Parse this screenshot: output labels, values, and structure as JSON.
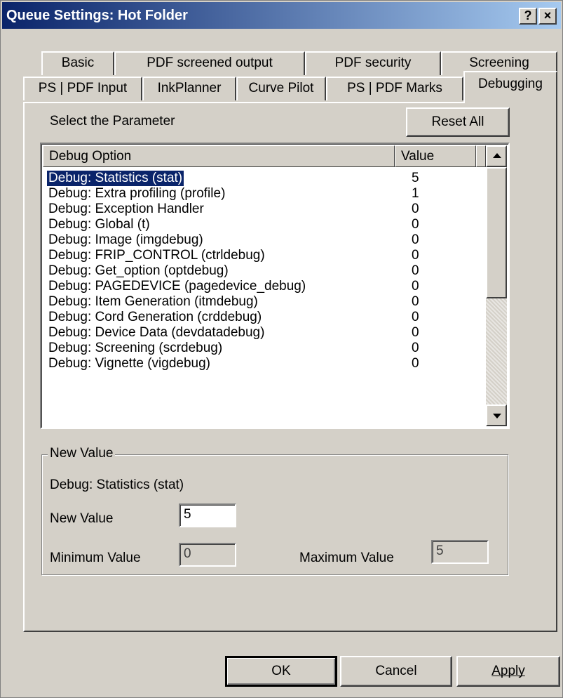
{
  "window": {
    "title": "Queue Settings: Hot Folder",
    "help_label": "?",
    "close_label": "×"
  },
  "tabs_row1": [
    {
      "label": "Basic"
    },
    {
      "label": "PDF screened output"
    },
    {
      "label": "PDF security"
    },
    {
      "label": "Screening"
    }
  ],
  "tabs_row2": [
    {
      "label": "PS | PDF Input"
    },
    {
      "label": "InkPlanner"
    },
    {
      "label": "Curve Pilot"
    },
    {
      "label": "PS | PDF Marks"
    },
    {
      "label": "Debugging"
    }
  ],
  "active_tab": "Debugging",
  "panel": {
    "select_label": "Select the Parameter",
    "reset_all_label": "Reset All"
  },
  "list": {
    "columns": [
      "Debug Option",
      "Value"
    ],
    "selected_index": 0,
    "rows": [
      {
        "option": "Debug: Statistics (stat)",
        "value": "5"
      },
      {
        "option": "Debug: Extra profiling (profile)",
        "value": "1"
      },
      {
        "option": "Debug: Exception Handler",
        "value": "0"
      },
      {
        "option": "Debug: Global (t)",
        "value": "0"
      },
      {
        "option": "Debug: Image (imgdebug)",
        "value": "0"
      },
      {
        "option": "Debug: FRIP_CONTROL (ctrldebug)",
        "value": "0"
      },
      {
        "option": "Debug: Get_option (optdebug)",
        "value": "0"
      },
      {
        "option": "Debug: PAGEDEVICE (pagedevice_debug)",
        "value": "0"
      },
      {
        "option": "Debug: Item Generation (itmdebug)",
        "value": "0"
      },
      {
        "option": "Debug: Cord Generation (crddebug)",
        "value": "0"
      },
      {
        "option": "Debug: Device Data (devdatadebug)",
        "value": "0"
      },
      {
        "option": "Debug: Screening (scrdebug)",
        "value": "0"
      },
      {
        "option": "Debug: Vignette (vigdebug)",
        "value": "0"
      }
    ]
  },
  "new_value_group": {
    "legend": "New Value",
    "selected_option": "Debug: Statistics (stat)",
    "new_value_label": "New Value",
    "new_value": "5",
    "min_label": "Minimum Value",
    "min_value": "0",
    "max_label": "Maximum Value",
    "max_value": "5"
  },
  "footer": {
    "ok_label": "OK",
    "cancel_label": "Cancel",
    "apply_label": "Apply"
  }
}
